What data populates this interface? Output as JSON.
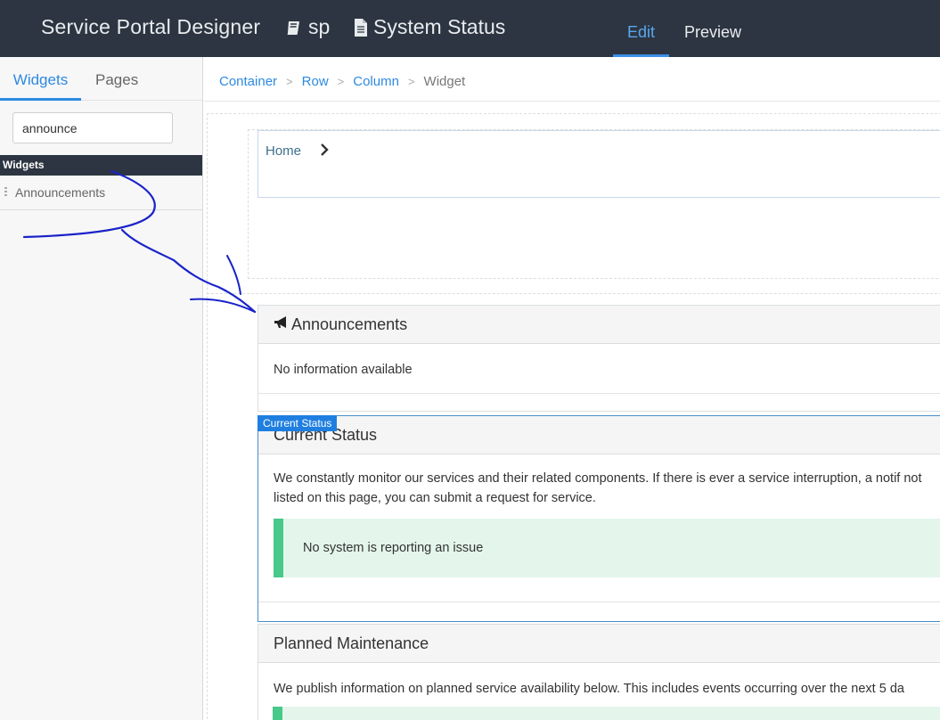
{
  "header": {
    "app_title": "Service Portal Designer",
    "portal_name": "sp",
    "page_name": "System Status",
    "tabs": {
      "edit": "Edit",
      "preview": "Preview"
    }
  },
  "sidebar": {
    "tabs": {
      "widgets": "Widgets",
      "pages": "Pages"
    },
    "search": {
      "value": "announce"
    },
    "section_title": "Widgets",
    "items": [
      {
        "label": "Announcements"
      }
    ]
  },
  "breadcrumb": {
    "container": "Container",
    "row": "Row",
    "column": "Column",
    "widget": "Widget",
    "separator": ">"
  },
  "canvas": {
    "home_link": "Home",
    "announcements": {
      "title": "Announcements",
      "body": "No information available"
    },
    "current_status": {
      "tag": "Current Status",
      "title": "Current Status",
      "body": "We constantly monitor our services and their related components. If there is ever a service interruption, a notif not listed on this page, you can submit a request for service.",
      "alert": "No system is reporting an issue"
    },
    "planned_maintenance": {
      "title": "Planned Maintenance",
      "body": "We publish information on planned service availability below. This includes events occurring over the next 5 da"
    }
  },
  "colors": {
    "header_bg": "#2c3541",
    "accent": "#2d8ae0",
    "success_bg": "#e4f6ec",
    "success_bar": "#48c98a",
    "annotation_ink": "#1a23c8"
  }
}
